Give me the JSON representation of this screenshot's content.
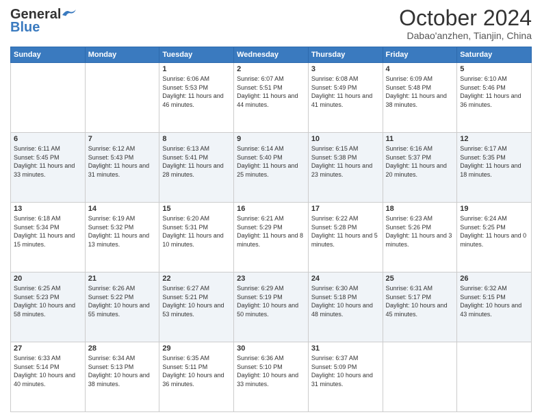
{
  "logo": {
    "line1": "General",
    "line2": "Blue"
  },
  "header": {
    "month": "October 2024",
    "location": "Dabao'anzhen, Tianjin, China"
  },
  "weekdays": [
    "Sunday",
    "Monday",
    "Tuesday",
    "Wednesday",
    "Thursday",
    "Friday",
    "Saturday"
  ],
  "weeks": [
    [
      {
        "day": "",
        "sunrise": "",
        "sunset": "",
        "daylight": ""
      },
      {
        "day": "",
        "sunrise": "",
        "sunset": "",
        "daylight": ""
      },
      {
        "day": "1",
        "sunrise": "Sunrise: 6:06 AM",
        "sunset": "Sunset: 5:53 PM",
        "daylight": "Daylight: 11 hours and 46 minutes."
      },
      {
        "day": "2",
        "sunrise": "Sunrise: 6:07 AM",
        "sunset": "Sunset: 5:51 PM",
        "daylight": "Daylight: 11 hours and 44 minutes."
      },
      {
        "day": "3",
        "sunrise": "Sunrise: 6:08 AM",
        "sunset": "Sunset: 5:49 PM",
        "daylight": "Daylight: 11 hours and 41 minutes."
      },
      {
        "day": "4",
        "sunrise": "Sunrise: 6:09 AM",
        "sunset": "Sunset: 5:48 PM",
        "daylight": "Daylight: 11 hours and 38 minutes."
      },
      {
        "day": "5",
        "sunrise": "Sunrise: 6:10 AM",
        "sunset": "Sunset: 5:46 PM",
        "daylight": "Daylight: 11 hours and 36 minutes."
      }
    ],
    [
      {
        "day": "6",
        "sunrise": "Sunrise: 6:11 AM",
        "sunset": "Sunset: 5:45 PM",
        "daylight": "Daylight: 11 hours and 33 minutes."
      },
      {
        "day": "7",
        "sunrise": "Sunrise: 6:12 AM",
        "sunset": "Sunset: 5:43 PM",
        "daylight": "Daylight: 11 hours and 31 minutes."
      },
      {
        "day": "8",
        "sunrise": "Sunrise: 6:13 AM",
        "sunset": "Sunset: 5:41 PM",
        "daylight": "Daylight: 11 hours and 28 minutes."
      },
      {
        "day": "9",
        "sunrise": "Sunrise: 6:14 AM",
        "sunset": "Sunset: 5:40 PM",
        "daylight": "Daylight: 11 hours and 25 minutes."
      },
      {
        "day": "10",
        "sunrise": "Sunrise: 6:15 AM",
        "sunset": "Sunset: 5:38 PM",
        "daylight": "Daylight: 11 hours and 23 minutes."
      },
      {
        "day": "11",
        "sunrise": "Sunrise: 6:16 AM",
        "sunset": "Sunset: 5:37 PM",
        "daylight": "Daylight: 11 hours and 20 minutes."
      },
      {
        "day": "12",
        "sunrise": "Sunrise: 6:17 AM",
        "sunset": "Sunset: 5:35 PM",
        "daylight": "Daylight: 11 hours and 18 minutes."
      }
    ],
    [
      {
        "day": "13",
        "sunrise": "Sunrise: 6:18 AM",
        "sunset": "Sunset: 5:34 PM",
        "daylight": "Daylight: 11 hours and 15 minutes."
      },
      {
        "day": "14",
        "sunrise": "Sunrise: 6:19 AM",
        "sunset": "Sunset: 5:32 PM",
        "daylight": "Daylight: 11 hours and 13 minutes."
      },
      {
        "day": "15",
        "sunrise": "Sunrise: 6:20 AM",
        "sunset": "Sunset: 5:31 PM",
        "daylight": "Daylight: 11 hours and 10 minutes."
      },
      {
        "day": "16",
        "sunrise": "Sunrise: 6:21 AM",
        "sunset": "Sunset: 5:29 PM",
        "daylight": "Daylight: 11 hours and 8 minutes."
      },
      {
        "day": "17",
        "sunrise": "Sunrise: 6:22 AM",
        "sunset": "Sunset: 5:28 PM",
        "daylight": "Daylight: 11 hours and 5 minutes."
      },
      {
        "day": "18",
        "sunrise": "Sunrise: 6:23 AM",
        "sunset": "Sunset: 5:26 PM",
        "daylight": "Daylight: 11 hours and 3 minutes."
      },
      {
        "day": "19",
        "sunrise": "Sunrise: 6:24 AM",
        "sunset": "Sunset: 5:25 PM",
        "daylight": "Daylight: 11 hours and 0 minutes."
      }
    ],
    [
      {
        "day": "20",
        "sunrise": "Sunrise: 6:25 AM",
        "sunset": "Sunset: 5:23 PM",
        "daylight": "Daylight: 10 hours and 58 minutes."
      },
      {
        "day": "21",
        "sunrise": "Sunrise: 6:26 AM",
        "sunset": "Sunset: 5:22 PM",
        "daylight": "Daylight: 10 hours and 55 minutes."
      },
      {
        "day": "22",
        "sunrise": "Sunrise: 6:27 AM",
        "sunset": "Sunset: 5:21 PM",
        "daylight": "Daylight: 10 hours and 53 minutes."
      },
      {
        "day": "23",
        "sunrise": "Sunrise: 6:29 AM",
        "sunset": "Sunset: 5:19 PM",
        "daylight": "Daylight: 10 hours and 50 minutes."
      },
      {
        "day": "24",
        "sunrise": "Sunrise: 6:30 AM",
        "sunset": "Sunset: 5:18 PM",
        "daylight": "Daylight: 10 hours and 48 minutes."
      },
      {
        "day": "25",
        "sunrise": "Sunrise: 6:31 AM",
        "sunset": "Sunset: 5:17 PM",
        "daylight": "Daylight: 10 hours and 45 minutes."
      },
      {
        "day": "26",
        "sunrise": "Sunrise: 6:32 AM",
        "sunset": "Sunset: 5:15 PM",
        "daylight": "Daylight: 10 hours and 43 minutes."
      }
    ],
    [
      {
        "day": "27",
        "sunrise": "Sunrise: 6:33 AM",
        "sunset": "Sunset: 5:14 PM",
        "daylight": "Daylight: 10 hours and 40 minutes."
      },
      {
        "day": "28",
        "sunrise": "Sunrise: 6:34 AM",
        "sunset": "Sunset: 5:13 PM",
        "daylight": "Daylight: 10 hours and 38 minutes."
      },
      {
        "day": "29",
        "sunrise": "Sunrise: 6:35 AM",
        "sunset": "Sunset: 5:11 PM",
        "daylight": "Daylight: 10 hours and 36 minutes."
      },
      {
        "day": "30",
        "sunrise": "Sunrise: 6:36 AM",
        "sunset": "Sunset: 5:10 PM",
        "daylight": "Daylight: 10 hours and 33 minutes."
      },
      {
        "day": "31",
        "sunrise": "Sunrise: 6:37 AM",
        "sunset": "Sunset: 5:09 PM",
        "daylight": "Daylight: 10 hours and 31 minutes."
      },
      {
        "day": "",
        "sunrise": "",
        "sunset": "",
        "daylight": ""
      },
      {
        "day": "",
        "sunrise": "",
        "sunset": "",
        "daylight": ""
      }
    ]
  ]
}
